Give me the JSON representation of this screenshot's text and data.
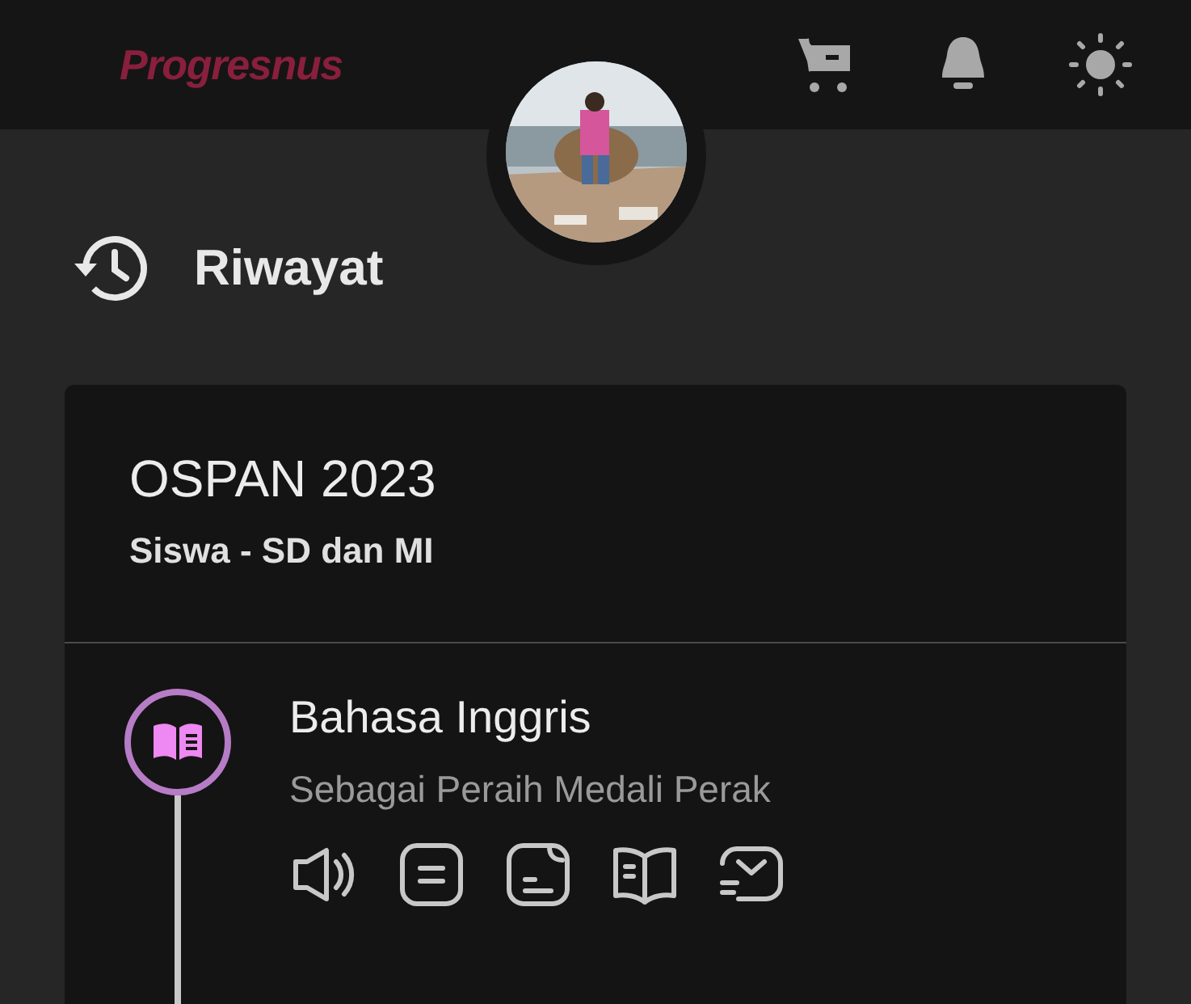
{
  "header": {
    "logo": "Progresnus"
  },
  "page": {
    "title": "Riwayat"
  },
  "card": {
    "event": "OSPAN 2023",
    "category": "Siswa - SD dan MI",
    "timeline": [
      {
        "subject": "Bahasa Inggris",
        "achievement": "Sebagai Peraih Medali Perak"
      }
    ]
  }
}
